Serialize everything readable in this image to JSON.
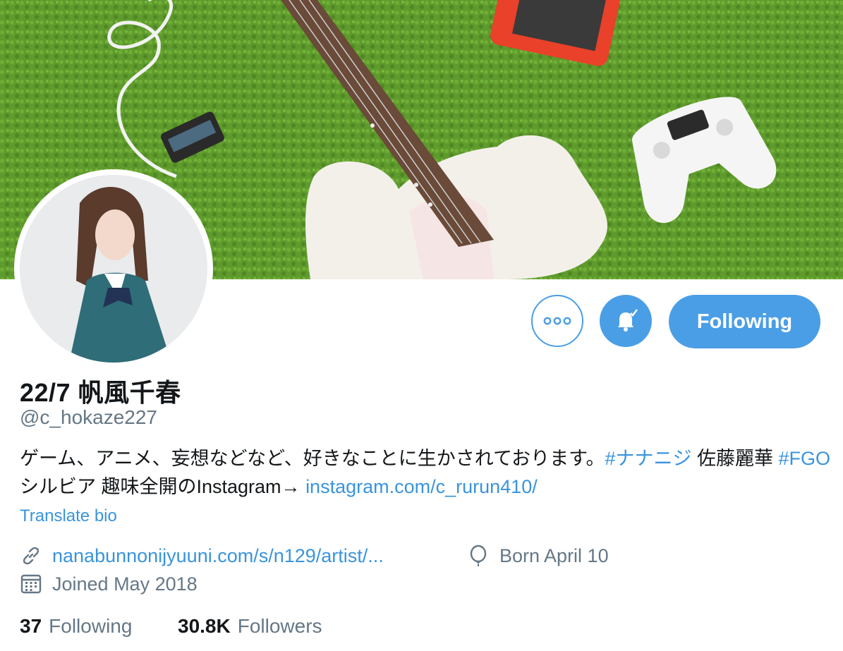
{
  "profile": {
    "display_name": "22/7 帆風千春",
    "handle": "@c_hokaze227",
    "bio": {
      "part1": "ゲーム、アニメ、妄想などなど、好きなことに生かされております。",
      "hashtag1": "#ナナニジ",
      "part2": " 佐藤麗華 ",
      "hashtag2": "#FGO",
      "part3": " シルビア 趣味全開のInstagram→ ",
      "link": "instagram.com/c_rurun410/"
    },
    "translate_label": "Translate bio",
    "website": "nanabunnonijyuuni.com/s/n129/artist/...",
    "birthday": "Born April 10",
    "joined": "Joined May 2018"
  },
  "actions": {
    "more_icon": "more-dots-icon",
    "notify_icon": "bell-check-icon",
    "follow_label": "Following"
  },
  "stats": {
    "following_count": "37",
    "following_label": "Following",
    "followers_count": "30.8K",
    "followers_label": "Followers"
  },
  "colors": {
    "accent": "#4a9ee6",
    "link": "#3a94dd",
    "muted": "#657786",
    "banner_grass": "#5e9a2c"
  }
}
